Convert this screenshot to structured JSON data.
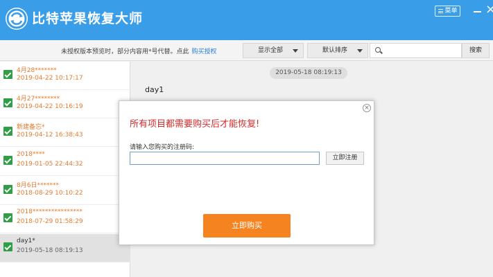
{
  "app": {
    "title": "比特苹果恢复大师",
    "menu_label": "菜单",
    "close_glyph": "×"
  },
  "toolbar": {
    "notice": "未授权版本预览时，部分内容用*号代替。点此",
    "buy_link": "购买授权",
    "filter_label": "显示全部",
    "sort_label": "默认排序",
    "search_placeholder": "",
    "search_label": "搜索"
  },
  "sidebar": {
    "items": [
      {
        "title": "4月28*******",
        "date": "2019-04-22 10:17:17",
        "checked": true,
        "selected": false
      },
      {
        "title": "4月27********",
        "date": "2019-04-22 10:16:19",
        "checked": true,
        "selected": false
      },
      {
        "title": "新建备忘*",
        "date": "2019-04-12 16:38:43",
        "checked": true,
        "selected": false
      },
      {
        "title": "2018****",
        "date": "2019-01-05 22:44:32",
        "checked": true,
        "selected": false
      },
      {
        "title": "8月6日*******",
        "date": "2018-08-29 10:10:22",
        "checked": true,
        "selected": false
      },
      {
        "title": "2018****************",
        "date": "2018-07-29 01:58:29",
        "checked": true,
        "selected": false
      },
      {
        "title": "day1*",
        "date": "2019-05-18 08:19:13",
        "checked": true,
        "selected": true
      }
    ]
  },
  "main": {
    "timestamp": "2019-05-18 08:19:13",
    "message": "day1"
  },
  "dialog": {
    "close_glyph": "×",
    "title": "所有项目都需要购买后才能恢复!",
    "reg_label": "请输入您购买的注册码:",
    "reg_value": "",
    "register_label": "立即注册",
    "buy_label": "立即购买"
  },
  "colors": {
    "titlebar": "#3a9de8",
    "check": "#2f9e46",
    "item_text": "#e57a2d",
    "buy_button": "#f58320",
    "alert_text": "#d42a2a",
    "link": "#2b7fd4"
  }
}
